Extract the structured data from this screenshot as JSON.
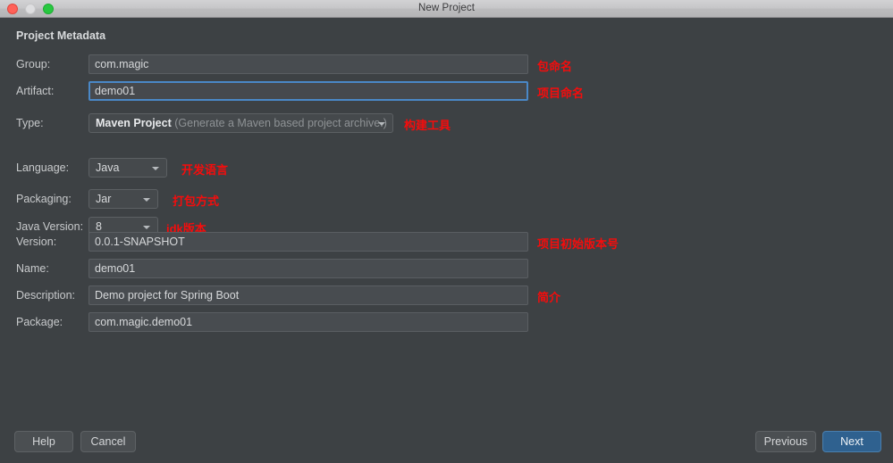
{
  "window": {
    "title": "New Project",
    "traffic_lights": [
      "close",
      "minimize",
      "maximize"
    ],
    "accent_blue": "#2f618f",
    "focus_blue": "#4a88c7",
    "annotation_red": "#f60c0c",
    "background": "#3d4144"
  },
  "section": {
    "heading": "Project Metadata"
  },
  "fields": {
    "group": {
      "label": "Group:",
      "value": "com.magic",
      "annotation": "包命名"
    },
    "artifact": {
      "label": "Artifact:",
      "value": "demo01",
      "annotation": "项目命名",
      "focused": true
    },
    "type": {
      "label": "Type:",
      "value": "Maven Project",
      "hint": "(Generate a Maven based project archive.)",
      "annotation": "构建工具"
    },
    "language": {
      "label": "Language:",
      "value": "Java",
      "annotation": "开发语言"
    },
    "packaging": {
      "label": "Packaging:",
      "value": "Jar",
      "annotation": "打包方式"
    },
    "java_version": {
      "label": "Java Version:",
      "value": "8",
      "annotation": "jdk版本"
    },
    "version": {
      "label": "Version:",
      "value": "0.0.1-SNAPSHOT",
      "annotation": "项目初始版本号"
    },
    "name": {
      "label": "Name:",
      "value": "demo01",
      "annotation": ""
    },
    "description": {
      "label": "Description:",
      "value": "Demo project for Spring Boot",
      "annotation": "简介"
    },
    "package": {
      "label": "Package:",
      "value": "com.magic.demo01",
      "annotation": ""
    }
  },
  "footer": {
    "help": "Help",
    "cancel": "Cancel",
    "previous": "Previous",
    "next": "Next"
  }
}
